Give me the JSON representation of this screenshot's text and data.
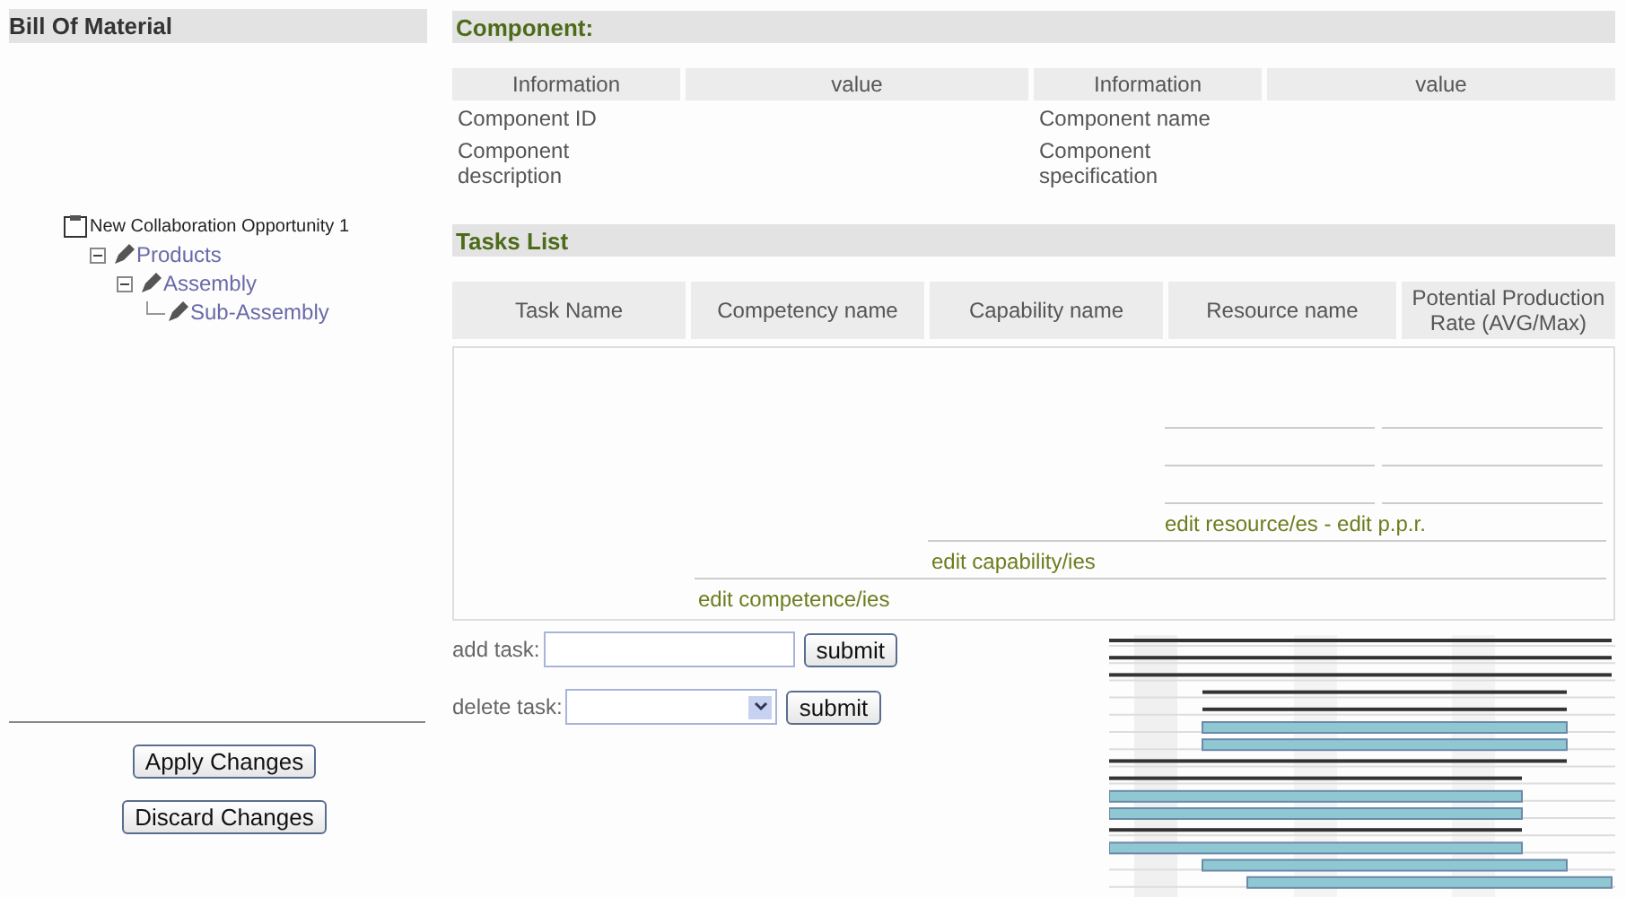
{
  "sidebar": {
    "title": "Bill Of Material",
    "tree": [
      {
        "label": "New Collaboration Opportunity 1",
        "kind": "root",
        "children": [
          {
            "label": "Products",
            "kind": "item",
            "expanded": true,
            "children": [
              {
                "label": "Assembly",
                "kind": "item",
                "expanded": true,
                "children": [
                  {
                    "label": "Sub-Assembly",
                    "kind": "item",
                    "expanded": false
                  }
                ]
              }
            ]
          }
        ]
      }
    ],
    "buttons": [
      "Apply Changes",
      "Discard Changes"
    ]
  },
  "component": {
    "title": "Component:",
    "columns": [
      "Information",
      "value",
      "Information",
      "value"
    ],
    "rows": [
      [
        "Component ID",
        "",
        "Component name",
        ""
      ],
      [
        "Component description",
        "",
        "Component specification",
        ""
      ]
    ]
  },
  "tasks": {
    "title": "Tasks List",
    "columns": [
      "Task Name",
      "Competency name",
      "Capability name",
      "Resource name",
      "Potential Production Rate (AVG/Max)"
    ],
    "links": {
      "resource": "edit resource/es - edit p.p.r.",
      "capability": "edit capability/ies",
      "competency": "edit competence/ies"
    },
    "add": {
      "label": "add task:",
      "button": "submit"
    },
    "delete": {
      "label": "delete task:",
      "button": "submit"
    }
  }
}
